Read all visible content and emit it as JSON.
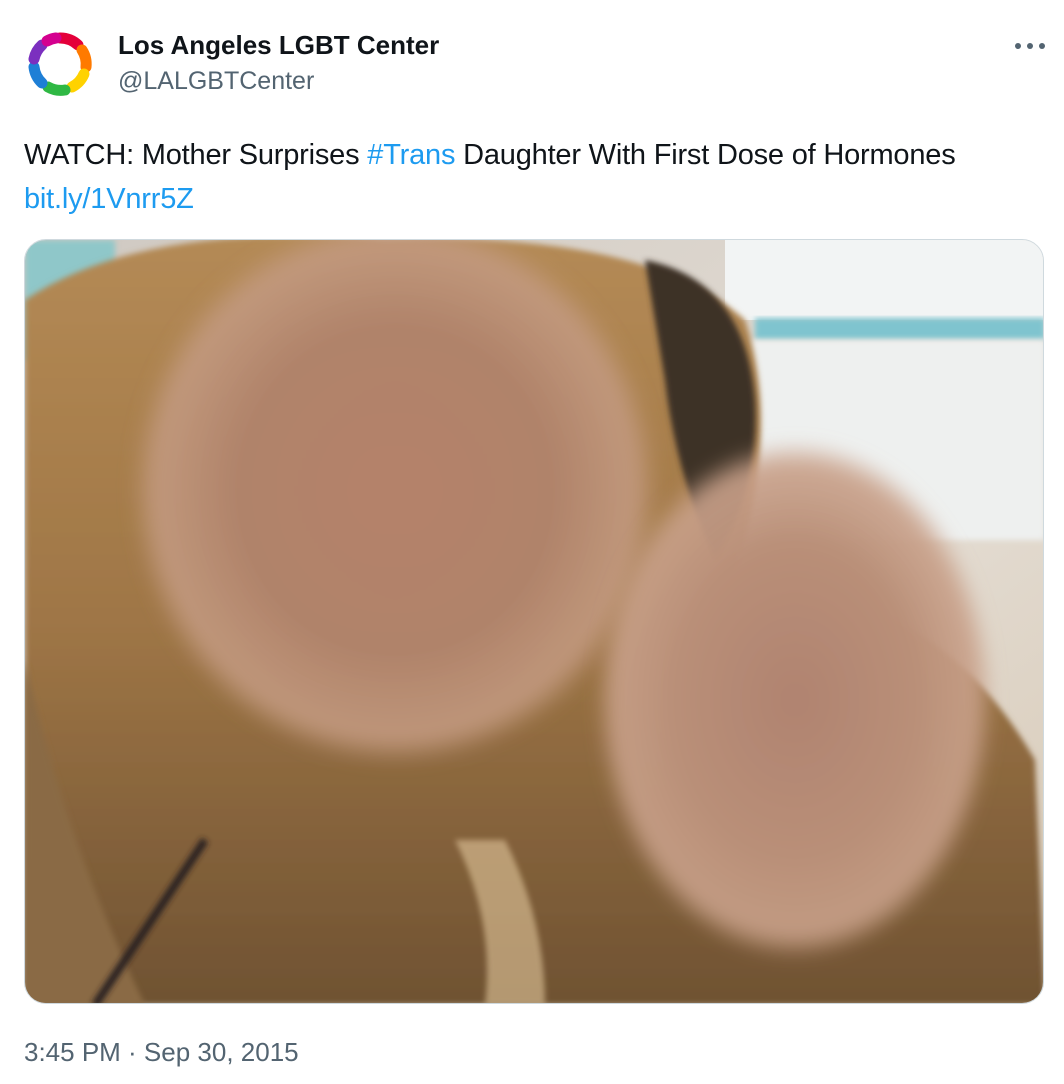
{
  "author": {
    "name": "Los Angeles LGBT Center",
    "handle": "@LALGBTCenter",
    "avatar_icon": "rainbow-ring-logo-icon"
  },
  "menu": {
    "more_icon": "more-horizontal-icon"
  },
  "tweet": {
    "text_prefix": "WATCH: Mother Surprises ",
    "hashtag": "#Trans",
    "text_suffix": " Daughter With First Dose of Hormones",
    "link": "bit.ly/1Vnrr5Z"
  },
  "media": {
    "description_icon": "photo-icon"
  },
  "timestamp": "3:45 PM · Sep 30, 2015",
  "colors": {
    "link": "#1d9bf0",
    "secondary_text": "#536471",
    "primary_text": "#0f1419",
    "border": "#cfd9de"
  }
}
